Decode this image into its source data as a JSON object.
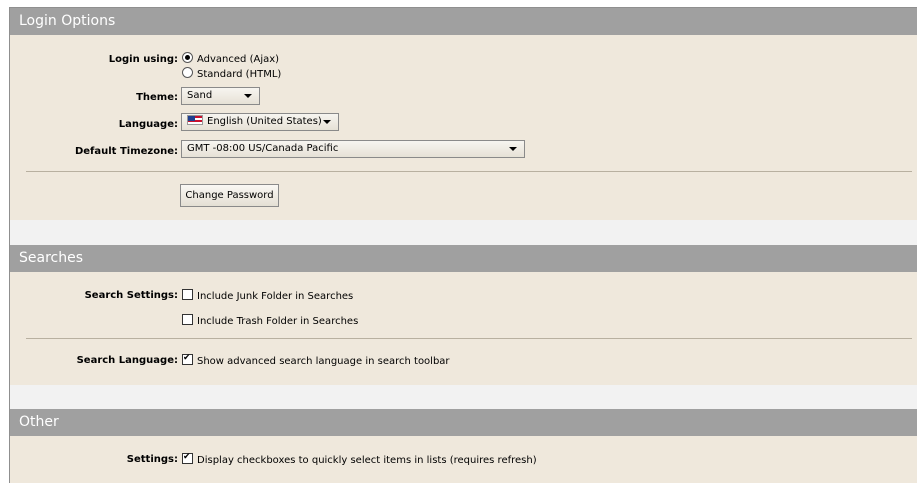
{
  "login_options": {
    "title": "Login Options",
    "login_using_label": "Login using:",
    "login_advanced": "Advanced (Ajax)",
    "login_standard": "Standard (HTML)",
    "theme_label": "Theme:",
    "theme_value": "Sand",
    "language_label": "Language:",
    "language_value": "English (United States)",
    "timezone_label": "Default Timezone:",
    "timezone_value": "GMT -08:00 US/Canada Pacific",
    "change_password": "Change Password"
  },
  "searches": {
    "title": "Searches",
    "settings_label": "Search Settings:",
    "include_junk": "Include Junk Folder in Searches",
    "include_trash": "Include Trash Folder in Searches",
    "language_label": "Search Language:",
    "show_advanced": "Show advanced search language in search toolbar"
  },
  "other": {
    "title": "Other",
    "settings_label": "Settings:",
    "display_checkboxes": "Display checkboxes to quickly select items in lists (requires refresh)"
  }
}
